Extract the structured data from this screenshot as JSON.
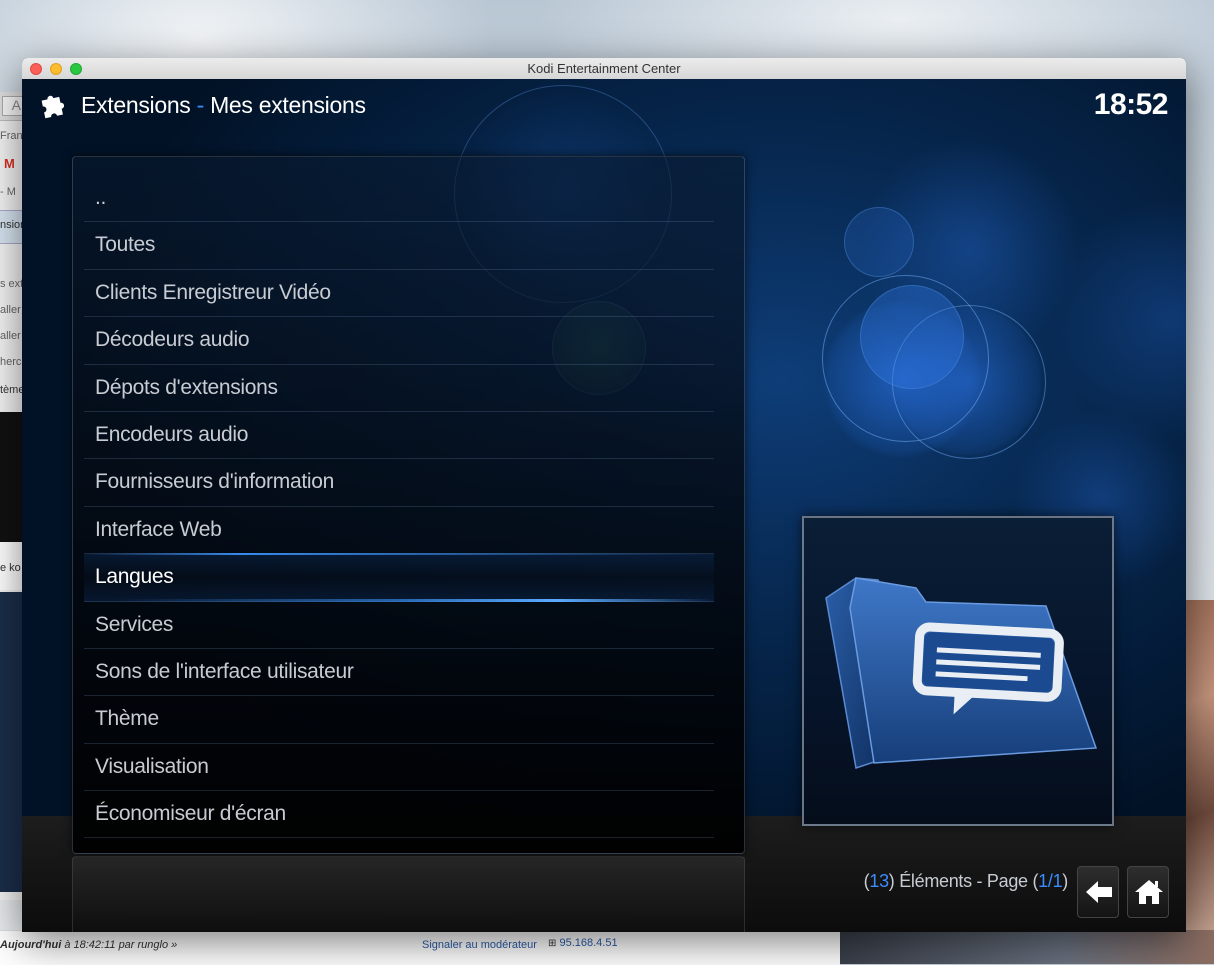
{
  "window": {
    "title": "Kodi Entertainment Center"
  },
  "header": {
    "section": "Extensions",
    "separator": "-",
    "subsection": "Mes extensions",
    "icon": "puzzle-icon"
  },
  "clock": "18:52",
  "list": {
    "selected_index": 8,
    "items": [
      {
        "label": ".."
      },
      {
        "label": "Toutes"
      },
      {
        "label": "Clients Enregistreur Vidéo"
      },
      {
        "label": "Décodeurs audio"
      },
      {
        "label": "Dépots d'extensions"
      },
      {
        "label": "Encodeurs audio"
      },
      {
        "label": "Fournisseurs d'information"
      },
      {
        "label": "Interface Web"
      },
      {
        "label": "Langues"
      },
      {
        "label": "Services"
      },
      {
        "label": "Sons de l'interface utilisateur"
      },
      {
        "label": "Thème"
      },
      {
        "label": "Visualisation"
      },
      {
        "label": "Économiseur d'écran"
      }
    ]
  },
  "preview": {
    "icon": "folder-speech-bubble-icon"
  },
  "footer": {
    "open1": "(",
    "count": "13",
    "close1": ")",
    "items_text": " Éléments - Page ",
    "open2": "(",
    "page": "1/1",
    "close2": ")"
  },
  "buttons": {
    "back_icon": "back-arrow-icon",
    "home_icon": "home-icon"
  },
  "background": {
    "tab_letter": "A",
    "sidebar_fragments": [
      "Fran",
      "- M",
      "nsion",
      "s exte",
      "aller",
      "aller",
      "herch",
      "tème",
      "e ko"
    ],
    "forum_footer_prefix": "Aujourd'hui",
    "forum_footer_rest": " à 18:42:11 par runglo »",
    "report_link": "Signaler au modérateur",
    "ip": "95.168.4.51"
  },
  "colors": {
    "accent": "#3a8cff",
    "kodi_bg": "#072850"
  }
}
